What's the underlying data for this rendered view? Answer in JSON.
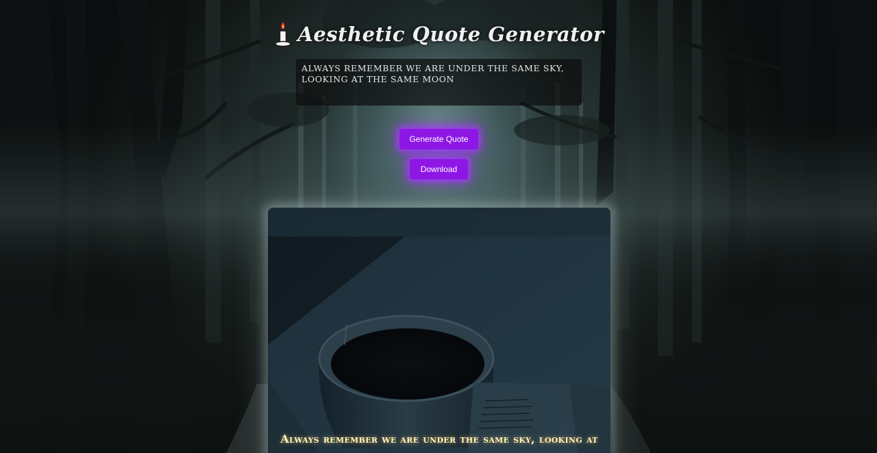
{
  "app": {
    "title": "Aesthetic Quote Generator",
    "title_icon": "candle-icon"
  },
  "quote_box": {
    "text": "Always remember we are under the same sky, looking at the same moon"
  },
  "buttons": {
    "generate_label": "Generate Quote",
    "download_label": "Download"
  },
  "card": {
    "quote_text": "Always remember we are under the same sky, looking at",
    "background_image": "dark-tea-cup-on-open-book"
  },
  "colors": {
    "button_accent": "#8e17e6",
    "button_glow": "#aa3cff",
    "card_text": "#fff5c6",
    "title_text": "#eef0f1"
  }
}
